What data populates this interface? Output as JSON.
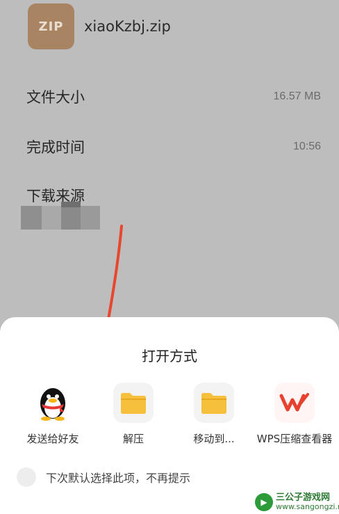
{
  "file": {
    "icon_text": "ZIP",
    "name": "xiaoKzbj.zip"
  },
  "info": [
    {
      "label": "文件大小",
      "value": "16.57 MB"
    },
    {
      "label": "完成时间",
      "value": "10:56"
    },
    {
      "label": "下载来源",
      "value": ""
    }
  ],
  "sheet": {
    "title": "打开方式",
    "apps": [
      {
        "label": "发送给好友",
        "icon": "qq-icon"
      },
      {
        "label": "解压",
        "icon": "folder-icon"
      },
      {
        "label": "移动到...",
        "icon": "folder-icon"
      },
      {
        "label": "WPS压缩查看器",
        "icon": "wps-icon"
      }
    ],
    "remember_label": "下次默认选择此项，不再提示"
  },
  "watermark": {
    "name": "三公子游戏网",
    "url": "www.sangongzi.net"
  },
  "colors": {
    "zip_icon": "#a98463",
    "overlay": "#bdbdbd",
    "arrow": "#e8472d",
    "folder": "#f7c03c",
    "wps": "#e8412f"
  }
}
